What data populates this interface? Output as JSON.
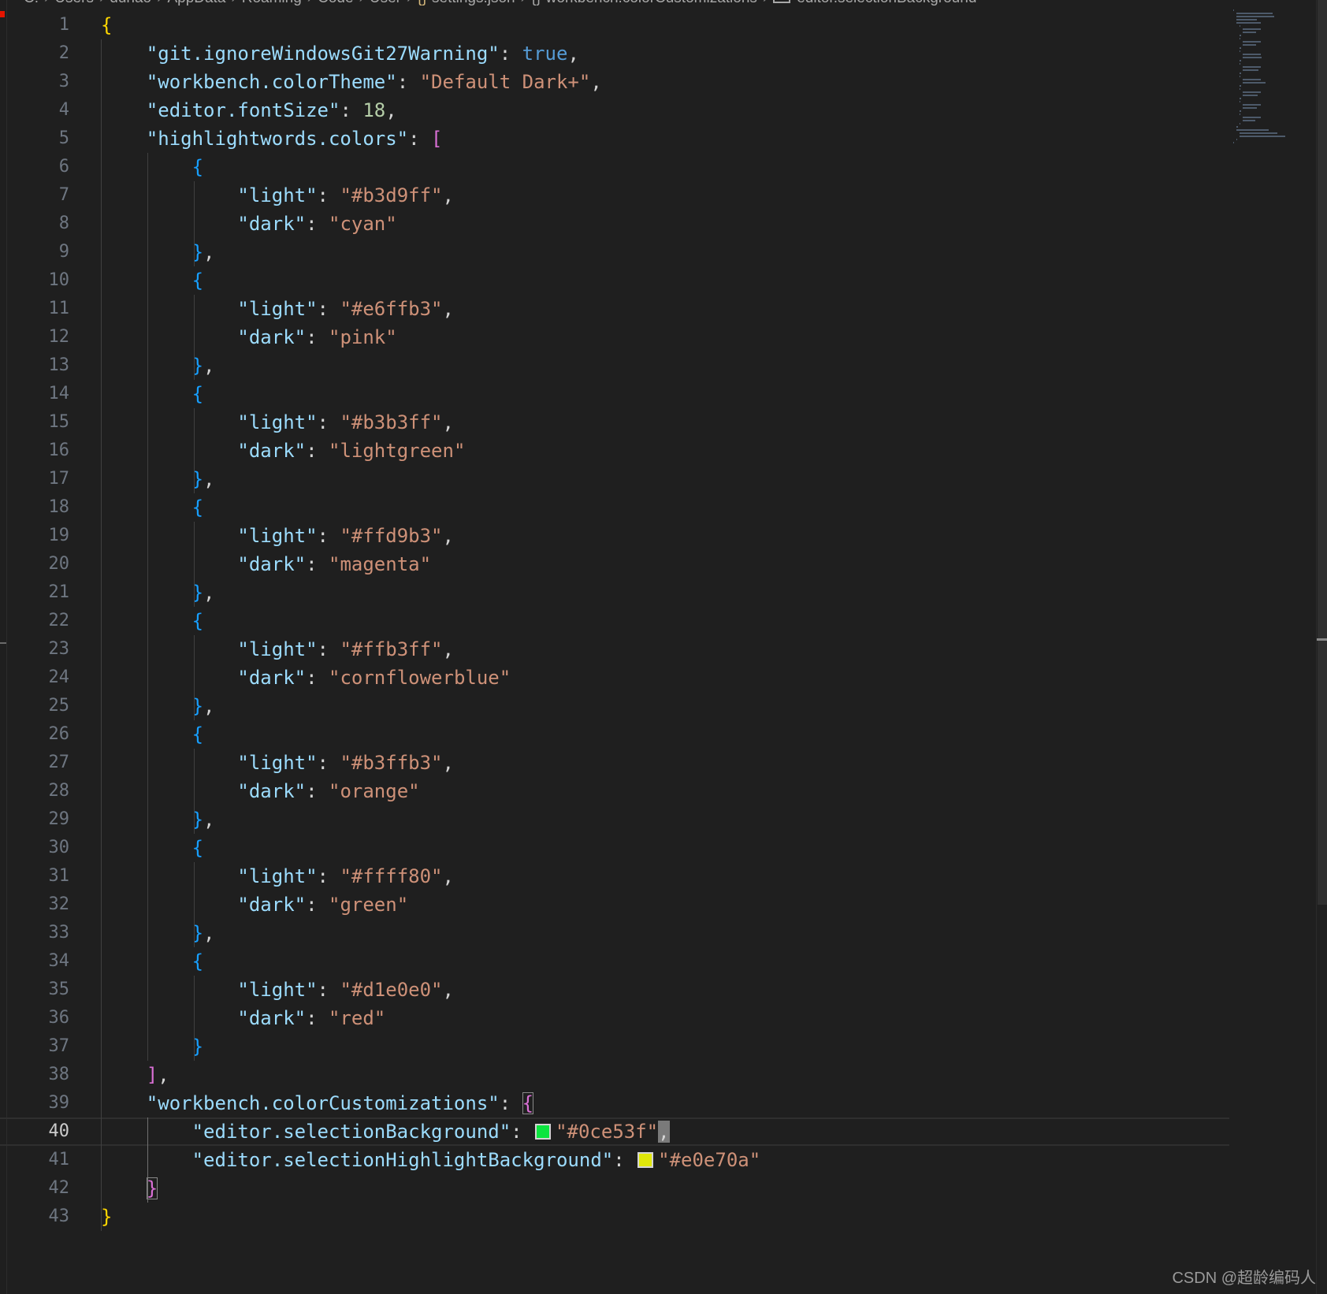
{
  "breadcrumb": {
    "segments": [
      "C:",
      "Users",
      "duhao",
      "AppData",
      "Roaming",
      "Code",
      "User",
      "settings.json",
      "workbench.colorCustomizations",
      "editor.selectionBackground"
    ]
  },
  "editor": {
    "current_line": 40,
    "lines": [
      {
        "n": "1",
        "indent": 0,
        "t": [
          [
            "{",
            "br1"
          ]
        ]
      },
      {
        "n": "2",
        "indent": 1,
        "t": [
          [
            "\"git.ignoreWindowsGit27Warning\"",
            "k"
          ],
          [
            ": ",
            "p"
          ],
          [
            "true",
            "b"
          ],
          [
            ",",
            "p"
          ]
        ]
      },
      {
        "n": "3",
        "indent": 1,
        "t": [
          [
            "\"workbench.colorTheme\"",
            "k"
          ],
          [
            ": ",
            "p"
          ],
          [
            "\"Default Dark+\"",
            "s"
          ],
          [
            ",",
            "p"
          ]
        ]
      },
      {
        "n": "4",
        "indent": 1,
        "t": [
          [
            "\"editor.fontSize\"",
            "k"
          ],
          [
            ": ",
            "p"
          ],
          [
            "18",
            "n"
          ],
          [
            ",",
            "p"
          ]
        ]
      },
      {
        "n": "5",
        "indent": 1,
        "t": [
          [
            "\"highlightwords.colors\"",
            "k"
          ],
          [
            ": ",
            "p"
          ],
          [
            "[",
            "br2"
          ]
        ]
      },
      {
        "n": "6",
        "indent": 2,
        "t": [
          [
            "{",
            "br3"
          ]
        ]
      },
      {
        "n": "7",
        "indent": 3,
        "t": [
          [
            "\"light\"",
            "k"
          ],
          [
            ": ",
            "p"
          ],
          [
            "\"#b3d9ff\"",
            "s"
          ],
          [
            ",",
            "p"
          ]
        ]
      },
      {
        "n": "8",
        "indent": 3,
        "t": [
          [
            "\"dark\"",
            "k"
          ],
          [
            ": ",
            "p"
          ],
          [
            "\"cyan\"",
            "s"
          ]
        ]
      },
      {
        "n": "9",
        "indent": 2,
        "t": [
          [
            "}",
            "br3"
          ],
          [
            ",",
            "p"
          ]
        ]
      },
      {
        "n": "10",
        "indent": 2,
        "t": [
          [
            "{",
            "br3"
          ]
        ]
      },
      {
        "n": "11",
        "indent": 3,
        "t": [
          [
            "\"light\"",
            "k"
          ],
          [
            ": ",
            "p"
          ],
          [
            "\"#e6ffb3\"",
            "s"
          ],
          [
            ",",
            "p"
          ]
        ]
      },
      {
        "n": "12",
        "indent": 3,
        "t": [
          [
            "\"dark\"",
            "k"
          ],
          [
            ": ",
            "p"
          ],
          [
            "\"pink\"",
            "s"
          ]
        ]
      },
      {
        "n": "13",
        "indent": 2,
        "t": [
          [
            "}",
            "br3"
          ],
          [
            ",",
            "p"
          ]
        ]
      },
      {
        "n": "14",
        "indent": 2,
        "t": [
          [
            "{",
            "br3"
          ]
        ]
      },
      {
        "n": "15",
        "indent": 3,
        "t": [
          [
            "\"light\"",
            "k"
          ],
          [
            ": ",
            "p"
          ],
          [
            "\"#b3b3ff\"",
            "s"
          ],
          [
            ",",
            "p"
          ]
        ]
      },
      {
        "n": "16",
        "indent": 3,
        "t": [
          [
            "\"dark\"",
            "k"
          ],
          [
            ": ",
            "p"
          ],
          [
            "\"lightgreen\"",
            "s"
          ]
        ]
      },
      {
        "n": "17",
        "indent": 2,
        "t": [
          [
            "}",
            "br3"
          ],
          [
            ",",
            "p"
          ]
        ]
      },
      {
        "n": "18",
        "indent": 2,
        "t": [
          [
            "{",
            "br3"
          ]
        ]
      },
      {
        "n": "19",
        "indent": 3,
        "t": [
          [
            "\"light\"",
            "k"
          ],
          [
            ": ",
            "p"
          ],
          [
            "\"#ffd9b3\"",
            "s"
          ],
          [
            ",",
            "p"
          ]
        ]
      },
      {
        "n": "20",
        "indent": 3,
        "t": [
          [
            "\"dark\"",
            "k"
          ],
          [
            ": ",
            "p"
          ],
          [
            "\"magenta\"",
            "s"
          ]
        ]
      },
      {
        "n": "21",
        "indent": 2,
        "t": [
          [
            "}",
            "br3"
          ],
          [
            ",",
            "p"
          ]
        ]
      },
      {
        "n": "22",
        "indent": 2,
        "t": [
          [
            "{",
            "br3"
          ]
        ]
      },
      {
        "n": "23",
        "indent": 3,
        "t": [
          [
            "\"light\"",
            "k"
          ],
          [
            ": ",
            "p"
          ],
          [
            "\"#ffb3ff\"",
            "s"
          ],
          [
            ",",
            "p"
          ]
        ]
      },
      {
        "n": "24",
        "indent": 3,
        "t": [
          [
            "\"dark\"",
            "k"
          ],
          [
            ": ",
            "p"
          ],
          [
            "\"cornflowerblue\"",
            "s"
          ]
        ]
      },
      {
        "n": "25",
        "indent": 2,
        "t": [
          [
            "}",
            "br3"
          ],
          [
            ",",
            "p"
          ]
        ]
      },
      {
        "n": "26",
        "indent": 2,
        "t": [
          [
            "{",
            "br3"
          ]
        ]
      },
      {
        "n": "27",
        "indent": 3,
        "t": [
          [
            "\"light\"",
            "k"
          ],
          [
            ": ",
            "p"
          ],
          [
            "\"#b3ffb3\"",
            "s"
          ],
          [
            ",",
            "p"
          ]
        ]
      },
      {
        "n": "28",
        "indent": 3,
        "t": [
          [
            "\"dark\"",
            "k"
          ],
          [
            ": ",
            "p"
          ],
          [
            "\"orange\"",
            "s"
          ]
        ]
      },
      {
        "n": "29",
        "indent": 2,
        "t": [
          [
            "}",
            "br3"
          ],
          [
            ",",
            "p"
          ]
        ]
      },
      {
        "n": "30",
        "indent": 2,
        "t": [
          [
            "{",
            "br3"
          ]
        ]
      },
      {
        "n": "31",
        "indent": 3,
        "t": [
          [
            "\"light\"",
            "k"
          ],
          [
            ": ",
            "p"
          ],
          [
            "\"#ffff80\"",
            "s"
          ],
          [
            ",",
            "p"
          ]
        ]
      },
      {
        "n": "32",
        "indent": 3,
        "t": [
          [
            "\"dark\"",
            "k"
          ],
          [
            ": ",
            "p"
          ],
          [
            "\"green\"",
            "s"
          ]
        ]
      },
      {
        "n": "33",
        "indent": 2,
        "t": [
          [
            "}",
            "br3"
          ],
          [
            ",",
            "p"
          ]
        ]
      },
      {
        "n": "34",
        "indent": 2,
        "t": [
          [
            "{",
            "br3"
          ]
        ]
      },
      {
        "n": "35",
        "indent": 3,
        "t": [
          [
            "\"light\"",
            "k"
          ],
          [
            ": ",
            "p"
          ],
          [
            "\"#d1e0e0\"",
            "s"
          ],
          [
            ",",
            "p"
          ]
        ]
      },
      {
        "n": "36",
        "indent": 3,
        "t": [
          [
            "\"dark\"",
            "k"
          ],
          [
            ": ",
            "p"
          ],
          [
            "\"red\"",
            "s"
          ]
        ]
      },
      {
        "n": "37",
        "indent": 2,
        "t": [
          [
            "}",
            "br3"
          ]
        ]
      },
      {
        "n": "38",
        "indent": 1,
        "t": [
          [
            "]",
            "br2"
          ],
          [
            ",",
            "p"
          ]
        ]
      },
      {
        "n": "39",
        "indent": 1,
        "t": [
          [
            "\"workbench.colorCustomizations\"",
            "k"
          ],
          [
            ": ",
            "p"
          ],
          [
            "{",
            "br2 boxed"
          ]
        ]
      },
      {
        "n": "40",
        "indent": 2,
        "t": [
          [
            "\"editor.selectionBackground\"",
            "k"
          ],
          [
            ": ",
            "p"
          ],
          [
            "#0ce53f",
            "swatch"
          ],
          [
            "\"#0ce53f\"",
            "s"
          ],
          [
            ",",
            "p cursor-comma"
          ]
        ]
      },
      {
        "n": "41",
        "indent": 2,
        "t": [
          [
            "\"editor.selectionHighlightBackground\"",
            "k"
          ],
          [
            ": ",
            "p"
          ],
          [
            "#e0e70a",
            "swatch"
          ],
          [
            "\"#e0e70a\"",
            "s"
          ]
        ]
      },
      {
        "n": "42",
        "indent": 1,
        "t": [
          [
            "}",
            "br2 boxed"
          ]
        ]
      },
      {
        "n": "43",
        "indent": 0,
        "t": [
          [
            "}",
            "br1"
          ]
        ]
      }
    ]
  },
  "watermark": "CSDN @超龄编码人"
}
